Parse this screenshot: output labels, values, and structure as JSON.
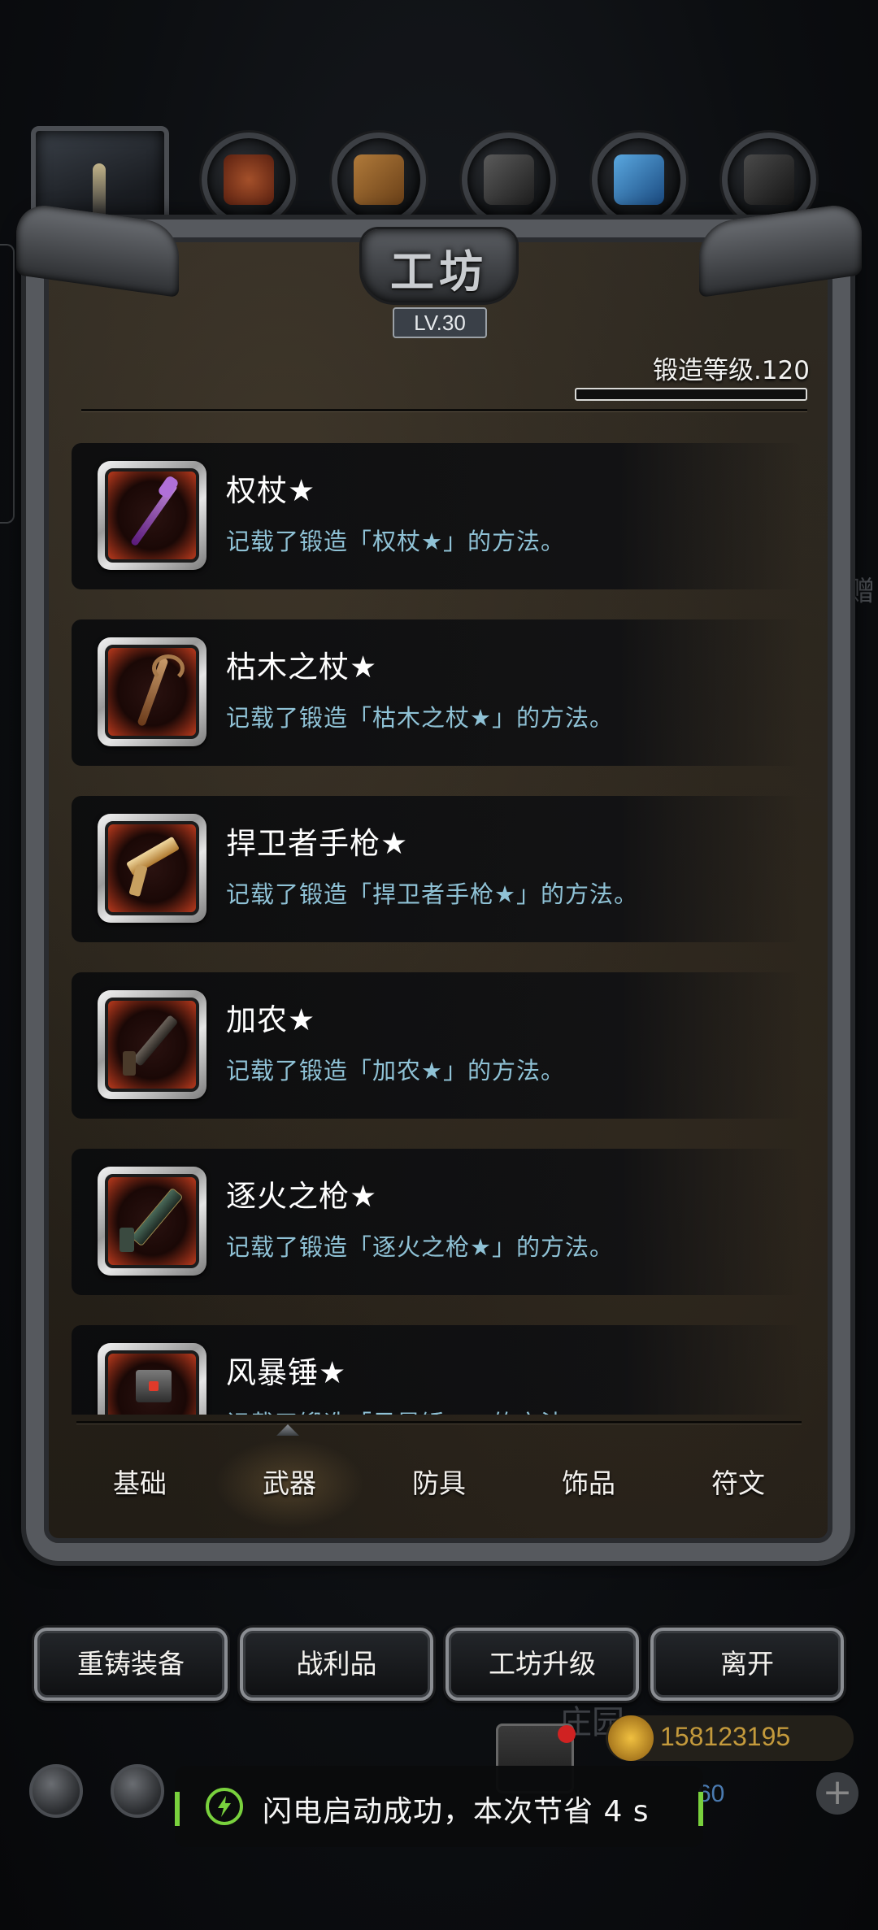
{
  "categories": [
    {
      "name": "campfire",
      "color": "#2b2f36"
    },
    {
      "name": "leather",
      "color": "#8a3a1e"
    },
    {
      "name": "wood",
      "color": "#8a5a2a"
    },
    {
      "name": "stone",
      "color": "#3a3a3a"
    },
    {
      "name": "crystal",
      "color": "#2f6fa8"
    },
    {
      "name": "iron",
      "color": "#3c3c3c"
    }
  ],
  "header": {
    "title": "工坊",
    "level_badge": "LV.30",
    "forge_level": "锻造等级.120",
    "forge_progress": 0.0
  },
  "recipes": [
    {
      "name": "权杖★",
      "desc": "记载了锻造「权杖★」的方法。",
      "icon": "scepter-icon"
    },
    {
      "name": "枯木之杖★",
      "desc": "记载了锻造「枯木之杖★」的方法。",
      "icon": "withered-staff-icon"
    },
    {
      "name": "捍卫者手枪★",
      "desc": "记载了锻造「捍卫者手枪★」的方法。",
      "icon": "defender-pistol-icon"
    },
    {
      "name": "加农★",
      "desc": "记载了锻造「加农★」的方法。",
      "icon": "cannon-icon"
    },
    {
      "name": "逐火之枪★",
      "desc": "记载了锻造「逐火之枪★」的方法。",
      "icon": "fire-chaser-gun-icon"
    },
    {
      "name": "风暴锤★",
      "desc": "记载了锻造「风暴锤★」的方法。",
      "icon": "storm-hammer-icon"
    }
  ],
  "tabs": {
    "items": [
      "基础",
      "武器",
      "防具",
      "饰品",
      "符文"
    ],
    "active": "武器"
  },
  "actions": [
    "重铸装备",
    "战利品",
    "工坊升级",
    "离开"
  ],
  "hud": {
    "coins": "158123195",
    "secondary": "60",
    "faint_label": "庄园",
    "plus": "+"
  },
  "toast": {
    "text": "闪电启动成功，本次节省 4 s",
    "accent": "#79d13d"
  },
  "side_hint": "赠"
}
